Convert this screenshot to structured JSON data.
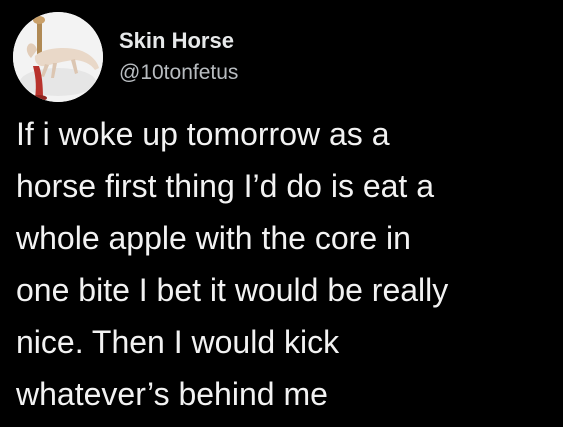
{
  "user": {
    "display_name": "Skin Horse",
    "handle": "@10tonfetus",
    "avatar_icon": "horse-figurine-avatar"
  },
  "tweet": {
    "lines": [
      "If i woke up tomorrow as a",
      "horse first thing I’d do is eat a",
      "whole apple with the core in",
      "one bite I bet it would be really",
      "nice. Then I would kick",
      "whatever’s behind me"
    ]
  },
  "colors": {
    "background": "#000000",
    "text": "#f2f2f2",
    "name": "#e7e9ea",
    "handle": "#b8bcc0"
  }
}
